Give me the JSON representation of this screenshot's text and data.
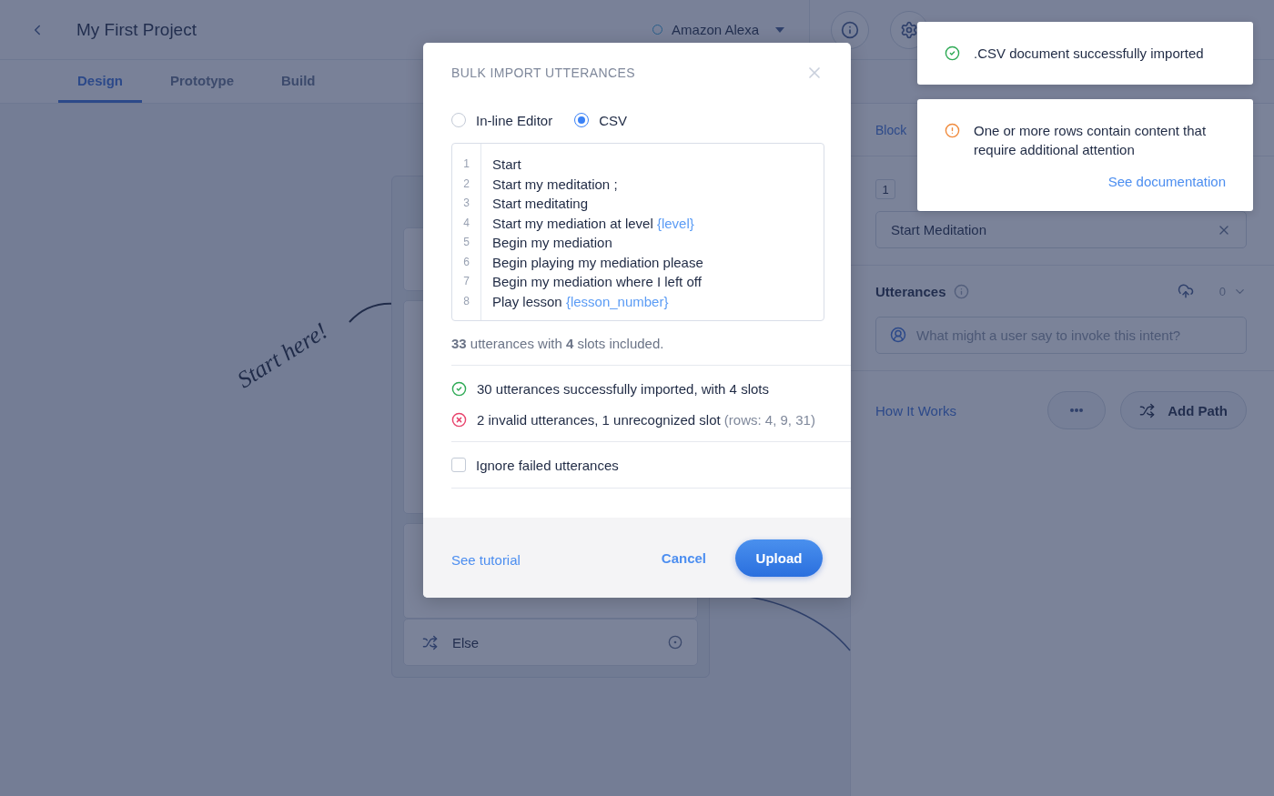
{
  "header": {
    "project_title": "My First Project",
    "platform": "Amazon Alexa"
  },
  "tabs": [
    {
      "label": "Design",
      "selected": true
    },
    {
      "label": "Prototype",
      "selected": false
    },
    {
      "label": "Build",
      "selected": false
    }
  ],
  "canvas": {
    "hint": "Start here!",
    "block": {
      "rows": [
        {
          "label": "Else"
        }
      ]
    }
  },
  "panel": {
    "breadcrumb": "Block",
    "step_number": "1",
    "intent_name": "Start Meditation",
    "utterances_title": "Utterances",
    "utterance_count": "0",
    "utterance_placeholder": "What might a user say to invoke this intent?",
    "help_link": "How It Works",
    "add_path": "Add Path"
  },
  "modal": {
    "title": "BULK IMPORT UTTERANCES",
    "modes": [
      {
        "label": "In-line Editor",
        "selected": false
      },
      {
        "label": "CSV",
        "selected": true
      }
    ],
    "lines": [
      {
        "number": "1",
        "text": "Start"
      },
      {
        "number": "2",
        "text": "Start my meditation ;"
      },
      {
        "number": "3",
        "text": "Start meditating"
      },
      {
        "number": "4",
        "text": "Start my mediation at level ",
        "slot": "{level}"
      },
      {
        "number": "5",
        "text": "Begin my mediation"
      },
      {
        "number": "6",
        "text": "Begin playing my mediation please"
      },
      {
        "number": "7",
        "text": "Begin my mediation where I left off"
      },
      {
        "number": "8",
        "text": "Play lesson ",
        "slot": "{lesson_number}"
      }
    ],
    "summary": "**33** utterances with **4** slots included.",
    "results": [
      {
        "kind": "success",
        "text": "30 utterances successfully imported, with 4 slots"
      },
      {
        "kind": "error",
        "text": "2 invalid utterances, 1 unrecognized slot",
        "detail": "(rows: 4, 9, 31)"
      }
    ],
    "ignore_failed": {
      "label": "Ignore failed utterances",
      "checked": false
    },
    "tutorial_link": "See tutorial",
    "cancel": "Cancel",
    "upload": "Upload"
  },
  "toasts": [
    {
      "kind": "success",
      "message": ".CSV document successfully imported"
    },
    {
      "kind": "warning",
      "message": "One or more rows contain content that require additional attention",
      "link": "See documentation"
    }
  ]
}
